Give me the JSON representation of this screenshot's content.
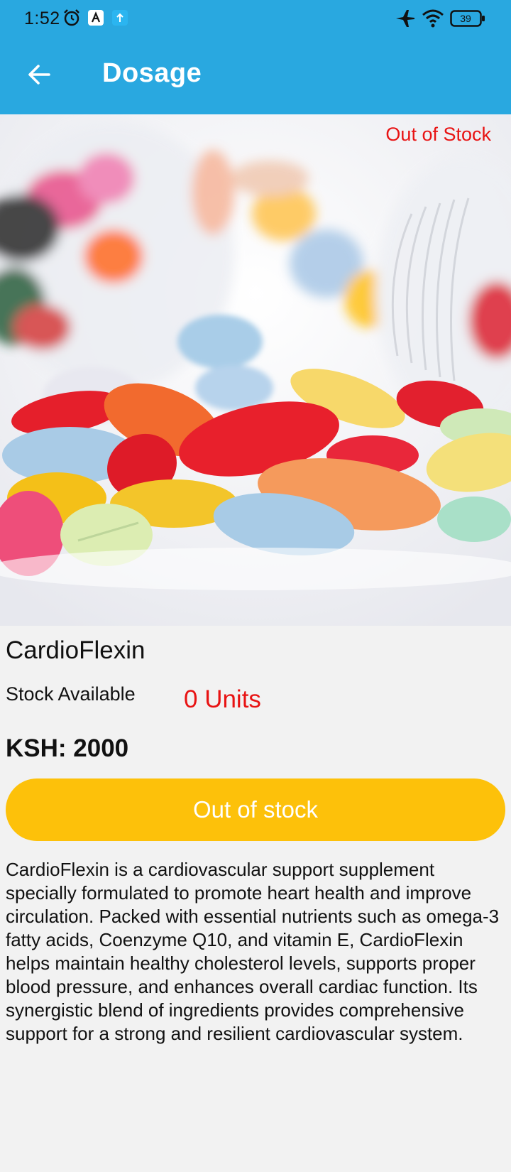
{
  "status_bar": {
    "time": "1:52",
    "battery": "39",
    "icons": [
      "alarm-icon",
      "app-notification-icon",
      "upload-notification-icon",
      "airplane-mode-icon",
      "wifi-icon",
      "battery-icon"
    ]
  },
  "toolbar": {
    "title": "Dosage",
    "back_icon": "arrow-left-icon"
  },
  "product": {
    "stock_flag": "Out of Stock",
    "name": "CardioFlexin",
    "stock_label": "Stock Available",
    "stock_value": "0 Units",
    "price": "KSH: 2000",
    "action_label": "Out of stock",
    "description": "CardioFlexin is a cardiovascular support supplement specially formulated to promote heart health and improve circulation. Packed with essential nutrients such as omega-3 fatty acids, Coenzyme Q10, and vitamin E, CardioFlexin helps maintain healthy cholesterol levels, supports proper blood pressure, and enhances overall cardiac function. Its synergistic blend of ingredients provides comprehensive support for a strong and resilient cardiovascular system."
  },
  "colors": {
    "app_bar": "#29a8e0",
    "accent_button": "#fdc10a",
    "alert_red": "#e81313",
    "background": "#f2f2f2"
  }
}
